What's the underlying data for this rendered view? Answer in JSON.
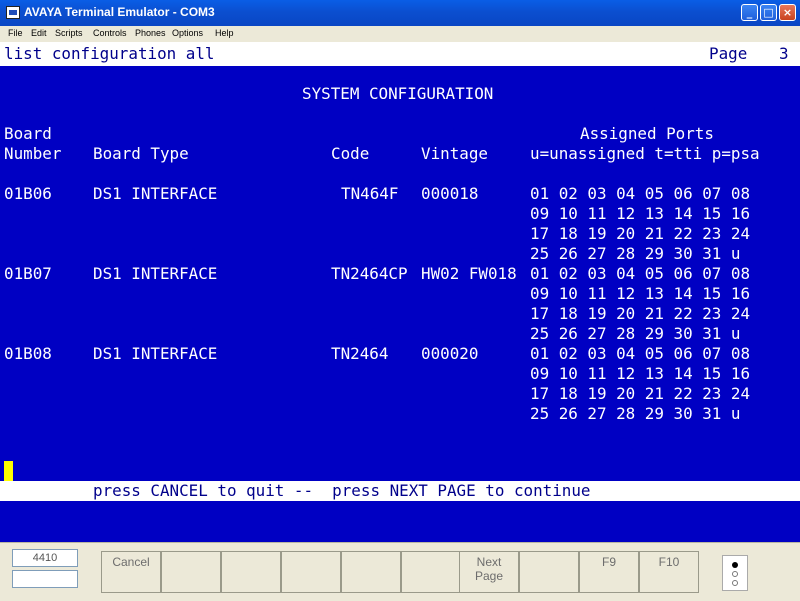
{
  "window": {
    "title": "AVAYA Terminal Emulator - COM3",
    "minimize": "_",
    "maximize": "□",
    "close": "×"
  },
  "menu": [
    "File",
    "Edit",
    "Scripts",
    "Controls",
    "Phones",
    "Options",
    "Help"
  ],
  "terminal": {
    "command": "list configuration all",
    "page_label": "Page",
    "page_number": "3",
    "heading": "SYSTEM CONFIGURATION",
    "headers": {
      "board_line1": "Board",
      "board_line2": "Number",
      "board_type": "Board Type",
      "code": "Code",
      "vintage": "Vintage",
      "assigned_ports": "Assigned Ports",
      "legend": "u=unassigned t=tti p=psa"
    },
    "rows": [
      {
        "board_number": "01B06",
        "board_type": "DS1 INTERFACE",
        "code": "TN464F",
        "vintage": "000018",
        "ports": [
          "01 02 03 04 05 06 07 08",
          "09 10 11 12 13 14 15 16",
          "17 18 19 20 21 22 23 24",
          "25 26 27 28 29 30 31 u"
        ]
      },
      {
        "board_number": "01B07",
        "board_type": "DS1 INTERFACE",
        "code": "TN2464CP",
        "vintage": "HW02 FW018",
        "ports": [
          "01 02 03 04 05 06 07 08",
          "09 10 11 12 13 14 15 16",
          "17 18 19 20 21 22 23 24",
          "25 26 27 28 29 30 31 u"
        ]
      },
      {
        "board_number": "01B08",
        "board_type": "DS1 INTERFACE",
        "code": "TN2464",
        "vintage": "000020",
        "ports": [
          "01 02 03 04 05 06 07 08",
          "09 10 11 12 13 14 15 16",
          "17 18 19 20 21 22 23 24",
          "25 26 27 28 29 30 31 u"
        ]
      }
    ],
    "message": "press CANCEL to quit --  press NEXT PAGE to continue"
  },
  "status": {
    "terminal_id": "4410"
  },
  "fkeys": [
    "Cancel",
    "",
    "",
    "",
    "",
    "",
    "Next Page",
    "",
    "F9",
    "F10"
  ]
}
